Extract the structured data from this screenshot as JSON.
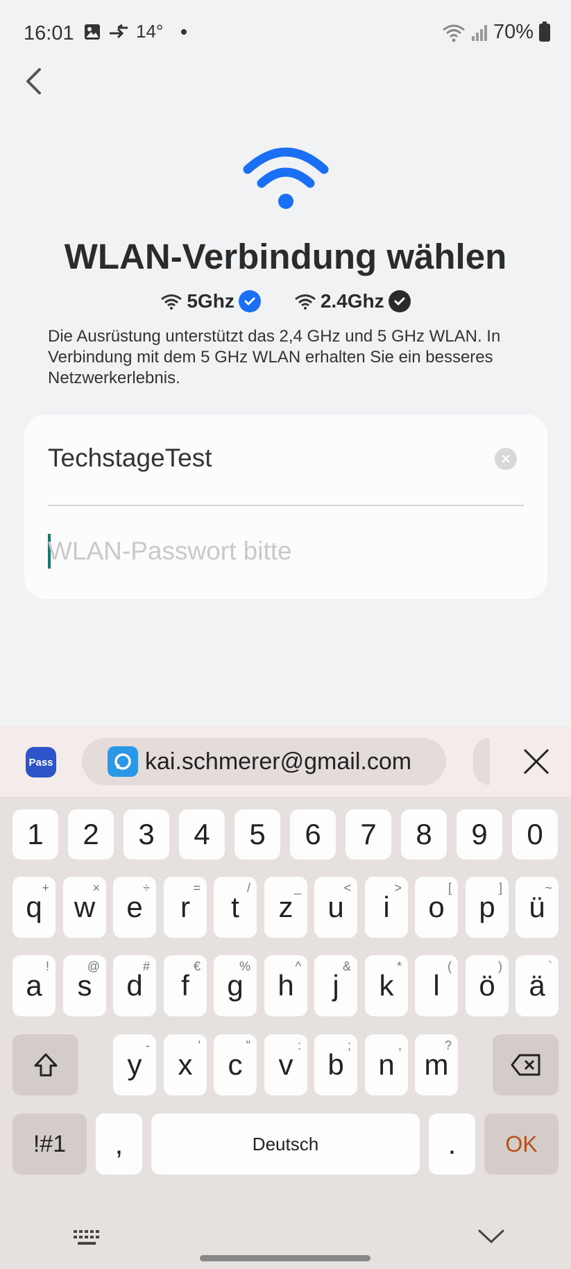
{
  "status_bar": {
    "time": "16:01",
    "temperature": "14°",
    "battery": "70%"
  },
  "page": {
    "title": "WLAN-Verbindung wählen",
    "bands": [
      {
        "label": "5Ghz",
        "checked": true,
        "check_color": "#1b6ff5"
      },
      {
        "label": "2.4Ghz",
        "checked": true,
        "check_color": "#2a2a2a"
      }
    ],
    "description": "Die Ausrüstung unterstützt das 2,4 GHz und 5 GHz WLAN. In Verbindung mit dem 5 GHz WLAN erhalten Sie ein besseres Netzwerkerlebnis.",
    "accent_color": "#1b6ff5"
  },
  "form": {
    "ssid": "TechstageTest",
    "password_placeholder": "WLAN-Passwort bitte",
    "password_value": ""
  },
  "suggestion_bar": {
    "pass_label": "Pass",
    "suggestion": "kai.schmerer@gmail.com"
  },
  "keyboard": {
    "number_row": [
      "1",
      "2",
      "3",
      "4",
      "5",
      "6",
      "7",
      "8",
      "9",
      "0"
    ],
    "row1": [
      {
        "k": "q",
        "h": "+"
      },
      {
        "k": "w",
        "h": "×"
      },
      {
        "k": "e",
        "h": "÷"
      },
      {
        "k": "r",
        "h": "="
      },
      {
        "k": "t",
        "h": "/"
      },
      {
        "k": "z",
        "h": "_"
      },
      {
        "k": "u",
        "h": "<"
      },
      {
        "k": "i",
        "h": ">"
      },
      {
        "k": "o",
        "h": "["
      },
      {
        "k": "p",
        "h": "]"
      },
      {
        "k": "ü",
        "h": "~"
      }
    ],
    "row2": [
      {
        "k": "a",
        "h": "!"
      },
      {
        "k": "s",
        "h": "@"
      },
      {
        "k": "d",
        "h": "#"
      },
      {
        "k": "f",
        "h": "€"
      },
      {
        "k": "g",
        "h": "%"
      },
      {
        "k": "h",
        "h": "^"
      },
      {
        "k": "j",
        "h": "&"
      },
      {
        "k": "k",
        "h": "*"
      },
      {
        "k": "l",
        "h": "("
      },
      {
        "k": "ö",
        "h": ")"
      },
      {
        "k": "ä",
        "h": "`"
      }
    ],
    "row3": [
      {
        "k": "y",
        "h": "-"
      },
      {
        "k": "x",
        "h": "'"
      },
      {
        "k": "c",
        "h": "\""
      },
      {
        "k": "v",
        "h": ":"
      },
      {
        "k": "b",
        "h": ";"
      },
      {
        "k": "n",
        "h": ","
      },
      {
        "k": "m",
        "h": "?"
      }
    ],
    "symbols_label": "!#1",
    "comma_label": ",",
    "space_label": "Deutsch",
    "period_label": ".",
    "ok_label": "OK"
  }
}
